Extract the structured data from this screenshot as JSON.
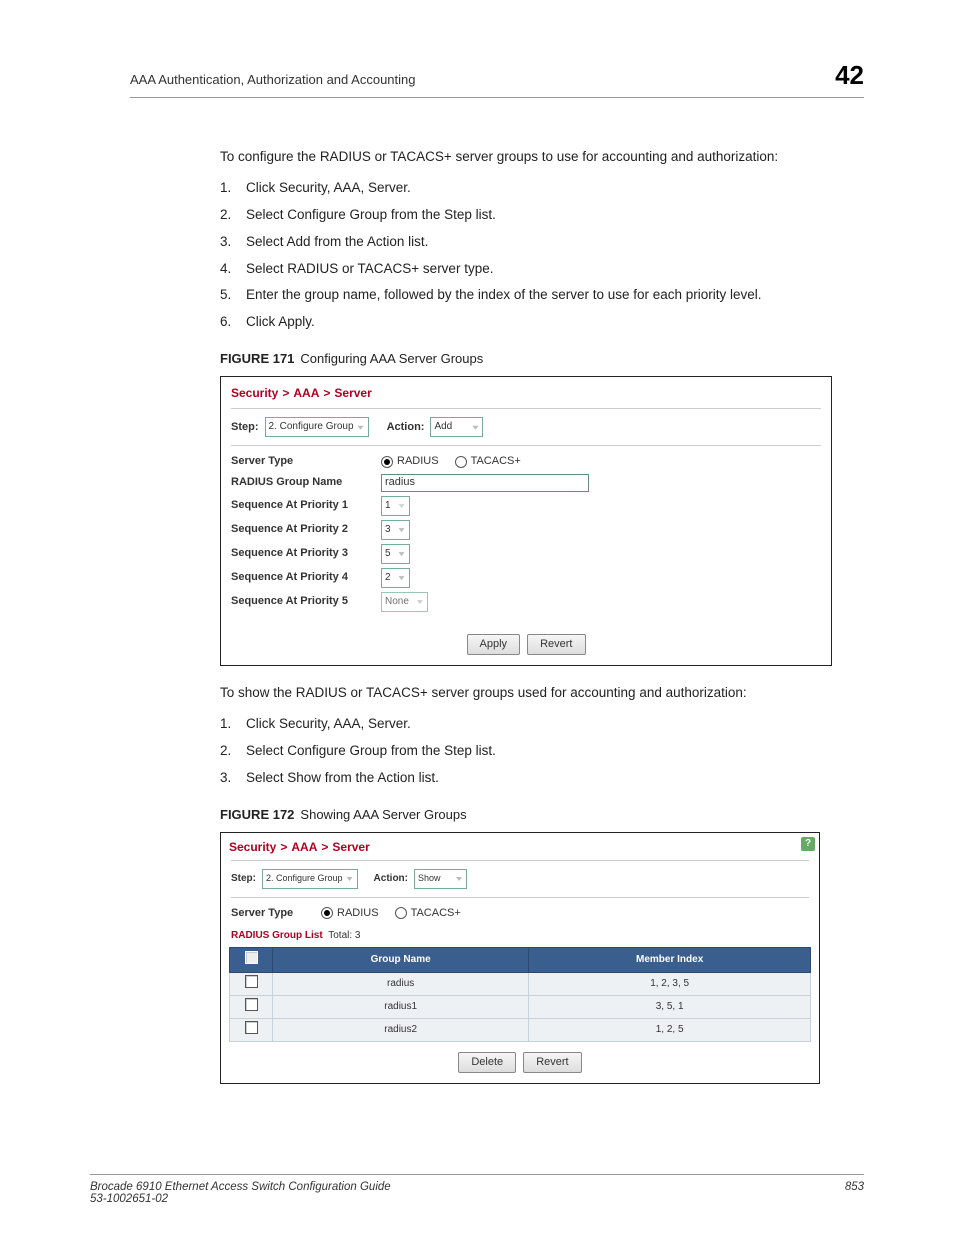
{
  "header": {
    "section": "AAA Authentication, Authorization and Accounting",
    "chapter": "42"
  },
  "intro1": "To configure the RADIUS or TACACS+ server groups to use for accounting and authorization:",
  "steps1": [
    "Click Security, AAA, Server.",
    "Select Configure Group from the Step list.",
    "Select Add from the Action list.",
    "Select RADIUS or TACACS+ server type.",
    "Enter the group name, followed by the index of the server to use for each priority level.",
    "Click Apply."
  ],
  "figure171": {
    "label": "FIGURE 171",
    "caption": "Configuring AAA Server Groups",
    "breadcrumb": [
      "Security",
      "AAA",
      "Server"
    ],
    "step_label": "Step:",
    "step_value": "2. Configure Group",
    "action_label": "Action:",
    "action_value": "Add",
    "server_type_label": "Server Type",
    "server_type_options": [
      "RADIUS",
      "TACACS+"
    ],
    "server_type_selected": "RADIUS",
    "group_name_label": "RADIUS Group Name",
    "group_name_value": "radius",
    "seq_label_prefix": "Sequence At Priority ",
    "seq_values": [
      "1",
      "3",
      "5",
      "2",
      "None"
    ],
    "apply": "Apply",
    "revert": "Revert"
  },
  "intro2": "To show the RADIUS or TACACS+ server groups used for accounting and authorization:",
  "steps2": [
    "Click Security, AAA, Server.",
    "Select Configure Group from the Step list.",
    "Select Show from the Action list."
  ],
  "figure172": {
    "label": "FIGURE 172",
    "caption": "Showing AAA Server Groups",
    "breadcrumb": [
      "Security",
      "AAA",
      "Server"
    ],
    "step_label": "Step:",
    "step_value": "2. Configure Group",
    "action_label": "Action:",
    "action_value": "Show",
    "server_type_label": "Server Type",
    "server_type_options": [
      "RADIUS",
      "TACACS+"
    ],
    "server_type_selected": "RADIUS",
    "list_label": "RADIUS Group List",
    "total_label": "Total:",
    "total_value": "3",
    "columns": [
      "Group Name",
      "Member Index"
    ],
    "rows": [
      {
        "name": "radius",
        "members": "1, 2, 3, 5"
      },
      {
        "name": "radius1",
        "members": "3, 5, 1"
      },
      {
        "name": "radius2",
        "members": "1, 2, 5"
      }
    ],
    "delete": "Delete",
    "revert": "Revert"
  },
  "footer": {
    "book": "Brocade 6910 Ethernet Access Switch Configuration Guide",
    "doc": "53-1002651-02",
    "page": "853"
  }
}
